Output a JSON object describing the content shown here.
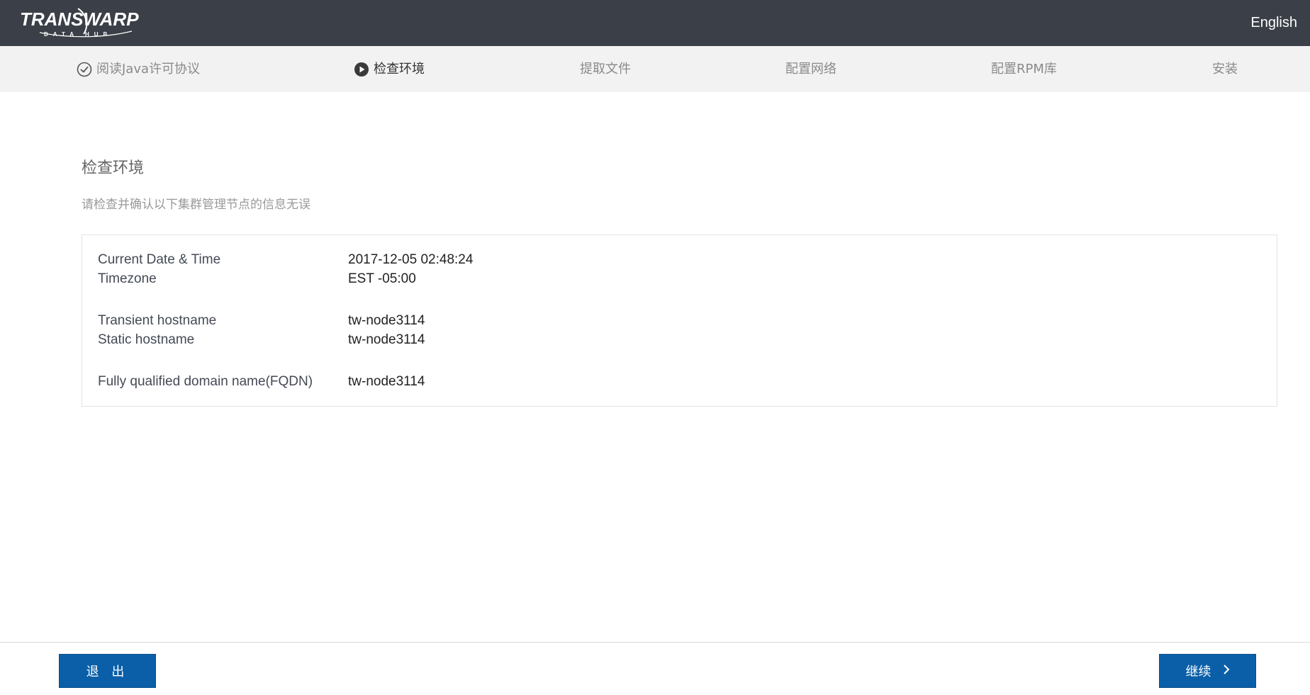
{
  "header": {
    "logo_main": "TRANSWARP",
    "logo_sub": "DATA HUB",
    "language": "English"
  },
  "steps": [
    {
      "label": "阅读Java许可协议",
      "state": "done"
    },
    {
      "label": "检查环境",
      "state": "active"
    },
    {
      "label": "提取文件",
      "state": "pending"
    },
    {
      "label": "配置网络",
      "state": "pending"
    },
    {
      "label": "配置RPM库",
      "state": "pending"
    },
    {
      "label": "安装",
      "state": "pending"
    }
  ],
  "main": {
    "title": "检查环境",
    "subtitle": "请检查并确认以下集群管理节点的信息无误",
    "info": [
      {
        "label": "Current Date & Time",
        "value": "2017-12-05 02:48:24"
      },
      {
        "label": "Timezone",
        "value": "EST -05:00"
      },
      {
        "label": "Transient hostname",
        "value": "tw-node3114"
      },
      {
        "label": "Static hostname",
        "value": "tw-node3114"
      },
      {
        "label": "Fully qualified domain name(FQDN)",
        "value": "tw-node3114"
      }
    ]
  },
  "footer": {
    "exit_label": "退 出",
    "next_label": "继续"
  },
  "colors": {
    "topbar": "#3b3f47",
    "stepbar": "#f2f2f2",
    "primary_button": "#0a5fa8"
  }
}
